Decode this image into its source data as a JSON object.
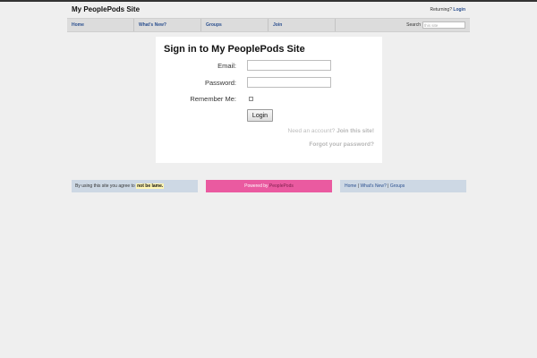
{
  "header": {
    "site_title": "My PeoplePods Site",
    "returning_text": "Returning?",
    "login_link": "Login"
  },
  "nav": {
    "items": [
      {
        "label": "Home"
      },
      {
        "label": "What's New?"
      },
      {
        "label": "Groups"
      },
      {
        "label": "Join"
      }
    ],
    "search_label": "Search",
    "search_placeholder": "this site"
  },
  "login_form": {
    "title": "Sign in to My PeoplePods Site",
    "email_label": "Email:",
    "email_value": "",
    "password_label": "Password:",
    "password_value": "",
    "remember_label": "Remember Me:",
    "remember_checked": false,
    "login_button": "Login",
    "need_account_text": "Need an account?",
    "join_link": "Join this site!",
    "forgot_link": "Forgot your password?"
  },
  "footer": {
    "agree_text": "By using this site you agree to",
    "lame_link": "not be lame.",
    "powered_text": "Powered by",
    "powered_link": "PeoplePods",
    "links": [
      {
        "label": "Home"
      },
      {
        "label": "What's New?"
      },
      {
        "label": "Groups"
      }
    ],
    "separator": "|"
  },
  "colors": {
    "background": "#efefef",
    "link_blue": "#2a4f8f",
    "footer_blue": "#cdd8e4",
    "footer_pink": "#ea5aa0"
  }
}
